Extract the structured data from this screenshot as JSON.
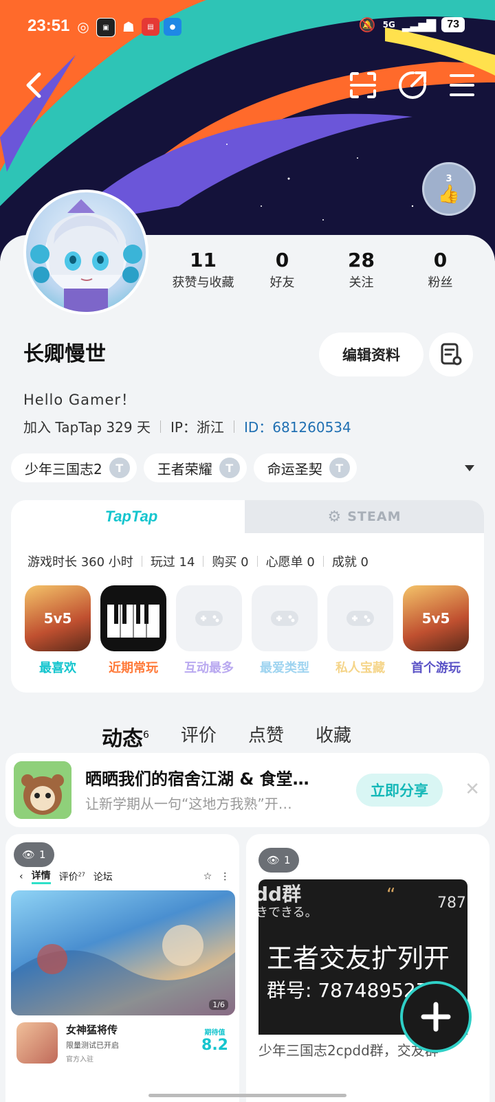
{
  "status_bar": {
    "time": "23:51",
    "network": "5G",
    "battery": "73",
    "app_icons": [
      "wechat-icon",
      "app-icon",
      "qq-icon",
      "toutiao-icon",
      "browser-icon"
    ]
  },
  "level_badge": {
    "level": "3"
  },
  "stats": [
    {
      "num": "11",
      "label": "获赞与收藏"
    },
    {
      "num": "0",
      "label": "好友"
    },
    {
      "num": "28",
      "label": "关注"
    },
    {
      "num": "0",
      "label": "粉丝"
    }
  ],
  "profile": {
    "username": "长卿慢世",
    "edit_label": "编辑资料",
    "bio": "Hello Gamer！",
    "joined": "加入 TapTap 329 天",
    "ip": "IP：浙江",
    "id": "ID：681260534"
  },
  "tags": [
    {
      "label": "少年三国志2",
      "badge": "T"
    },
    {
      "label": "王者荣耀",
      "badge": "T"
    },
    {
      "label": "命运圣契",
      "badge": "T"
    }
  ],
  "game_card": {
    "tab_taptap": "TapTap",
    "tab_steam": "STEAM",
    "stats": [
      "游戏时长 360 小时",
      "玩过 14",
      "购买 0",
      "心愿单 0",
      "成就 0"
    ],
    "items": [
      {
        "label": "最喜欢",
        "color": "#15c5ce"
      },
      {
        "label": "近期常玩",
        "color": "#ff7a3a"
      },
      {
        "label": "互动最多",
        "color": "#b9a9f0"
      },
      {
        "label": "最爱类型",
        "color": "#9fd4f0"
      },
      {
        "label": "私人宝藏",
        "color": "#f5d58a"
      },
      {
        "label": "首个游玩",
        "color": "#5a52c6"
      }
    ]
  },
  "profile_tabs": [
    {
      "label": "动态",
      "count": "6"
    },
    {
      "label": "评价"
    },
    {
      "label": "点赞"
    },
    {
      "label": "收藏"
    }
  ],
  "promo": {
    "title": "晒晒我们的宿舍江湖 & 食堂…",
    "subtitle": "让新学期从一句“这地方我熟”开…",
    "share_label": "立即分享"
  },
  "feed_left": {
    "views": "1",
    "nav": {
      "tab1": "详情",
      "tab2": "评价",
      "tab2_count": "27",
      "tab3": "论坛"
    },
    "page": "1/6",
    "game_title": "女神猛将传",
    "game_sub": "限量测试已开启",
    "game_tag": "官方入驻",
    "score_label": "期待值",
    "score": "8.2"
  },
  "feed_right": {
    "views": "1",
    "img_top": "dd群",
    "img_top2": "きできる。",
    "img_num": "787",
    "img_line1": "王者交友扩列开",
    "img_line2": "群号: 787489527",
    "caption": "少年三国志2cpdd群，交友群"
  }
}
